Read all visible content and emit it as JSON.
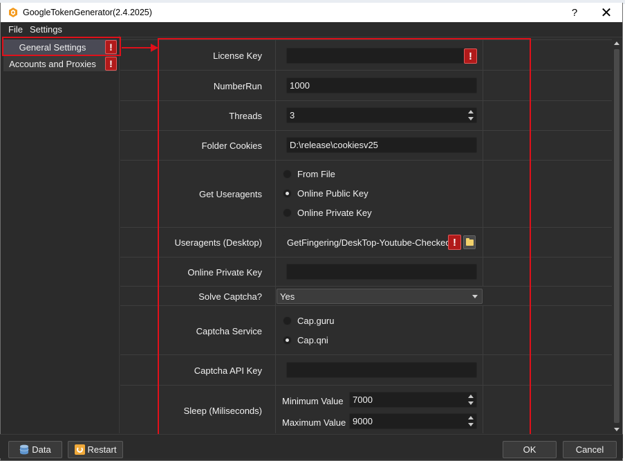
{
  "window": {
    "title": "GoogleTokenGenerator(2.4.2025)",
    "help_label": "?",
    "close_label": "✕"
  },
  "menu": [
    "File",
    "Settings"
  ],
  "nav": {
    "items": [
      {
        "label": "General Settings",
        "warning": "!",
        "active": true
      },
      {
        "label": "Accounts and Proxies",
        "warning": "!",
        "active": false
      }
    ]
  },
  "form": {
    "license_key": {
      "label": "License Key",
      "value": "",
      "warning": "!"
    },
    "number_run": {
      "label": "NumberRun",
      "value": "1000"
    },
    "threads": {
      "label": "Threads",
      "value": "3"
    },
    "folder_cookies": {
      "label": "Folder Cookies",
      "value": "D:\\release\\cookiesv25"
    },
    "get_useragents": {
      "label": "Get Useragents",
      "options": [
        "From File",
        "Online Public Key",
        "Online Private Key"
      ],
      "selected": "Online Public Key"
    },
    "useragents_desktop": {
      "label": "Useragents (Desktop)",
      "value": "GetFingering/DeskTop-Youtube-Checked.",
      "warning": "!"
    },
    "online_private_key": {
      "label": "Online Private Key",
      "value": ""
    },
    "solve_captcha": {
      "label": "Solve Captcha?",
      "value": "Yes"
    },
    "captcha_service": {
      "label": "Captcha Service",
      "options": [
        "Cap.guru",
        "Cap.qni"
      ],
      "selected": "Cap.qni"
    },
    "captcha_api_key": {
      "label": "Captcha API Key",
      "value": ""
    },
    "sleep": {
      "label": "Sleep (Miliseconds)",
      "min_label": "Minimum Value",
      "min_value": "7000",
      "max_label": "Maximum Value",
      "max_value": "9000"
    }
  },
  "footer": {
    "data_label": "Data",
    "restart_label": "Restart",
    "ok_label": "OK",
    "cancel_label": "Cancel"
  },
  "colors": {
    "highlight": "#e0101a",
    "warning": "#b11a1a",
    "background": "#2d2d2d",
    "input": "#1e1e1e"
  }
}
